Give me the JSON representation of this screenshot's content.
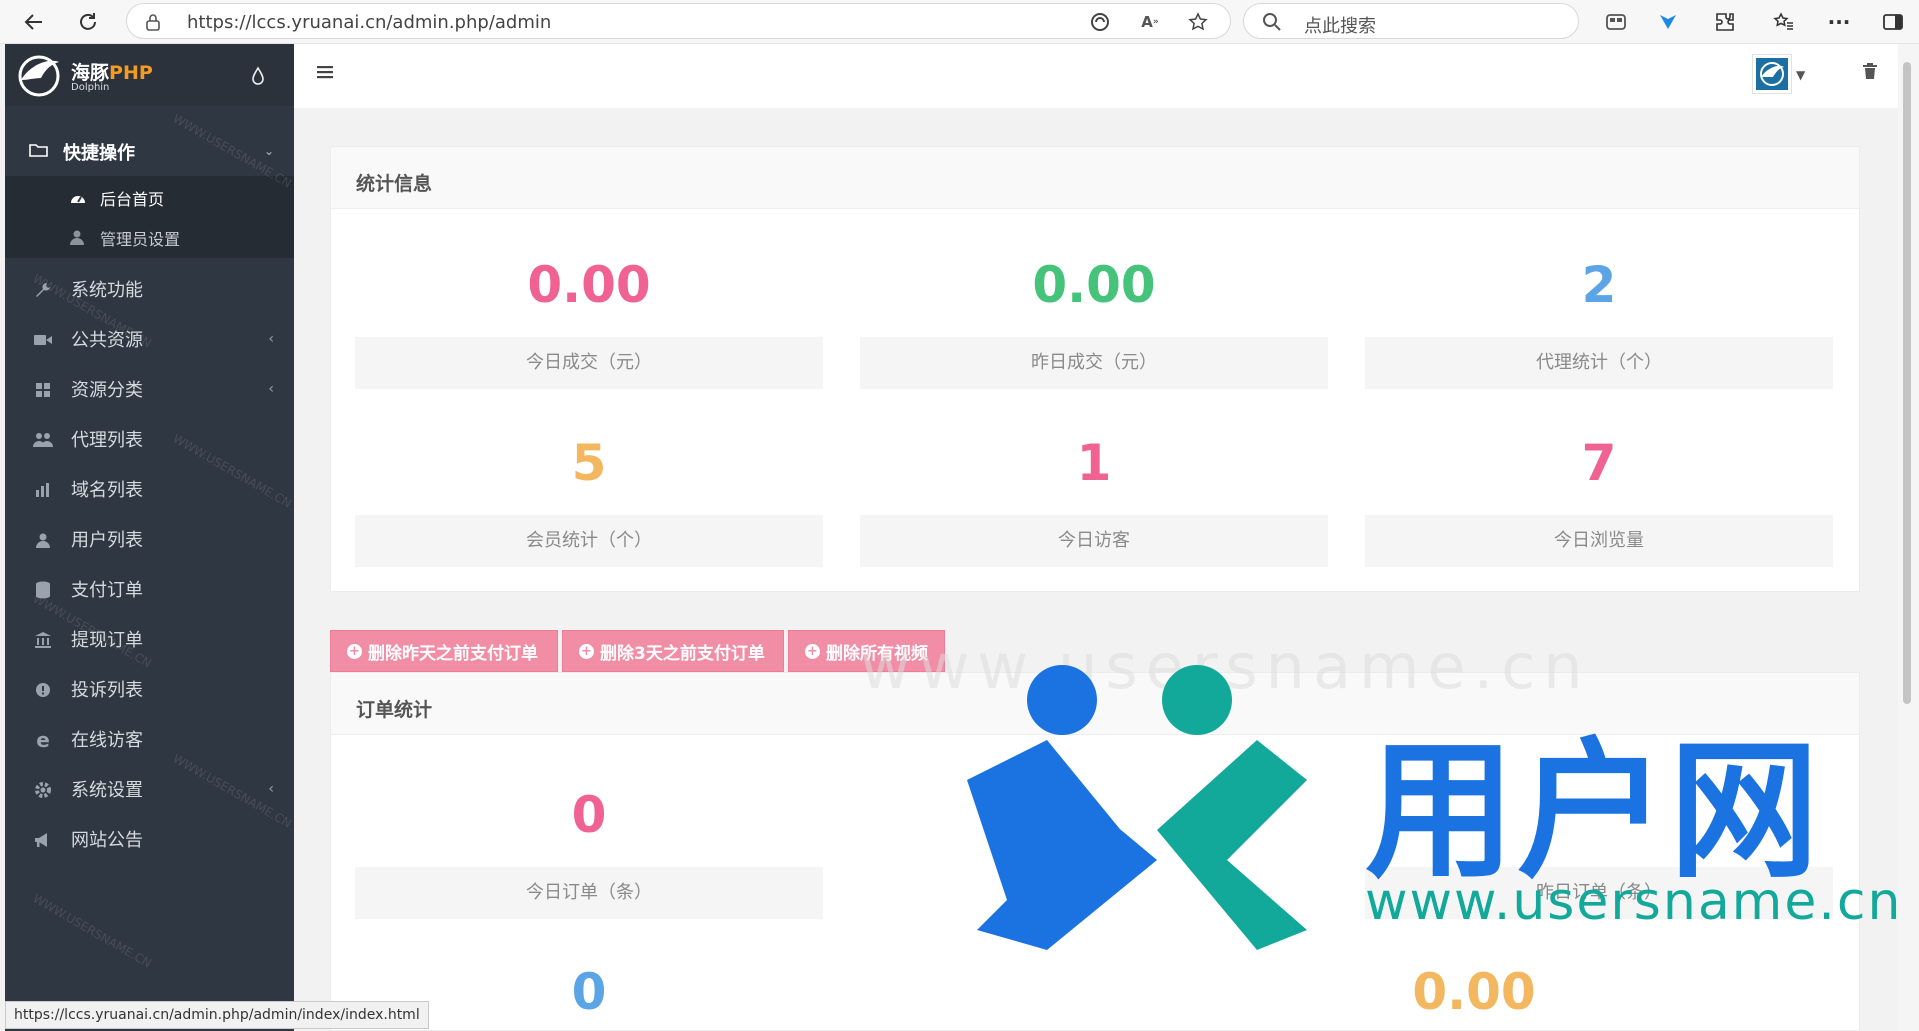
{
  "browser": {
    "url": "https://lccs.yruanai.cn/admin.php/admin",
    "search_placeholder": "点此搜索",
    "status_url": "https://lccs.yruanai.cn/admin.php/admin/index/index.html"
  },
  "brand": {
    "name_cn": "海豚",
    "name_php": "PHP",
    "subtitle": "Dolphin"
  },
  "sidebar": {
    "group_label": "快捷操作",
    "sub_items": [
      {
        "label": "后台首页",
        "icon": "dashboard-icon"
      },
      {
        "label": "管理员设置",
        "icon": "user-icon"
      }
    ],
    "items": [
      {
        "label": "系统功能",
        "icon": "wrench-icon"
      },
      {
        "label": "公共资源",
        "icon": "video-icon",
        "caret": "‹"
      },
      {
        "label": "资源分类",
        "icon": "grid-icon",
        "caret": "‹"
      },
      {
        "label": "代理列表",
        "icon": "users-icon"
      },
      {
        "label": "域名列表",
        "icon": "chart-icon"
      },
      {
        "label": "用户列表",
        "icon": "user-icon"
      },
      {
        "label": "支付订单",
        "icon": "database-icon"
      },
      {
        "label": "提现订单",
        "icon": "bank-icon"
      },
      {
        "label": "投诉列表",
        "icon": "alert-icon"
      },
      {
        "label": "在线访客",
        "icon": "ie-icon"
      },
      {
        "label": "系统设置",
        "icon": "cog-icon",
        "caret": "‹"
      },
      {
        "label": "网站公告",
        "icon": "bullhorn-icon"
      }
    ]
  },
  "stats_panel": {
    "title": "统计信息",
    "cards": [
      {
        "value": "0.00",
        "label": "今日成交（元）",
        "color": "#f06292"
      },
      {
        "value": "0.00",
        "label": "昨日成交（元）",
        "color": "#46c37b"
      },
      {
        "value": "2",
        "label": "代理统计（个）",
        "color": "#5ba4e5"
      },
      {
        "value": "5",
        "label": "会员统计（个）",
        "color": "#f3b760"
      },
      {
        "value": "1",
        "label": "今日访客",
        "color": "#f06292"
      },
      {
        "value": "7",
        "label": "今日浏览量",
        "color": "#f06292"
      }
    ]
  },
  "action_buttons": [
    {
      "label": "删除昨天之前支付订单"
    },
    {
      "label": "删除3天之前支付订单"
    },
    {
      "label": "删除所有视频"
    }
  ],
  "orders_panel": {
    "title": "订单统计",
    "cards": [
      {
        "value": "0",
        "label": "今日订单（条）",
        "color": "#f06292"
      },
      {
        "value": "",
        "label": "",
        "color": "#46c37b"
      },
      {
        "value": "",
        "label": "昨日订单（条）",
        "color": "#46c37b"
      },
      {
        "value": "0",
        "label": "",
        "color": "#5ba4e5"
      },
      {
        "value": "0.00",
        "label": "",
        "color": "#f3b760"
      }
    ]
  },
  "watermark": {
    "brand_text": "用户网",
    "brand_url": "www.usersname.cn",
    "faint_url": "www.usersname.cn",
    "diag": "WWW.USERSNAME.CN"
  },
  "colors": {
    "sidebar_bg": "#2f3742",
    "accent_pink": "#f28da6"
  }
}
